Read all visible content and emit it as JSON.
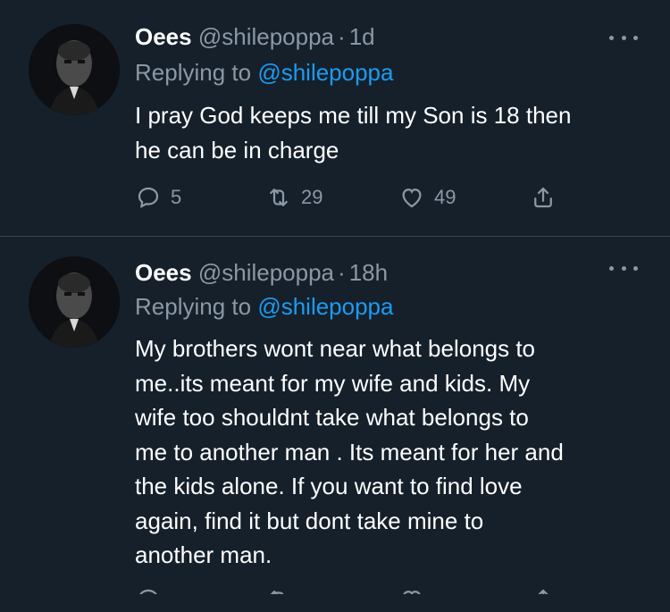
{
  "tweets": [
    {
      "name": "Oees",
      "handle": "@shilepoppa",
      "dot": "·",
      "time": "1d",
      "replying_prefix": "Replying to",
      "replying_to": "@shilepoppa",
      "text": "I pray God keeps me till my Son is 18 then\nhe can be in charge",
      "replies": "5",
      "retweets": "29",
      "likes": "49"
    },
    {
      "name": "Oees",
      "handle": "@shilepoppa",
      "dot": "·",
      "time": "18h",
      "replying_prefix": "Replying to",
      "replying_to": "@shilepoppa",
      "text": "My brothers wont near what belongs to\nme..its meant for my wife and kids. My\nwife too shouldnt take what belongs to\nme to another man . Its meant for  her and\nthe kids alone. If you want to find love\nagain, find it but dont take mine to\nanother man."
    }
  ],
  "icons": {
    "reply": "reply-icon",
    "retweet": "retweet-icon",
    "like": "heart-icon",
    "share": "share-icon",
    "more": "more-icon"
  },
  "colors": {
    "background": "#15202b",
    "text": "#ffffff",
    "secondary": "#8b98a5",
    "accent": "#1d9bf0",
    "divider": "#38444d"
  }
}
